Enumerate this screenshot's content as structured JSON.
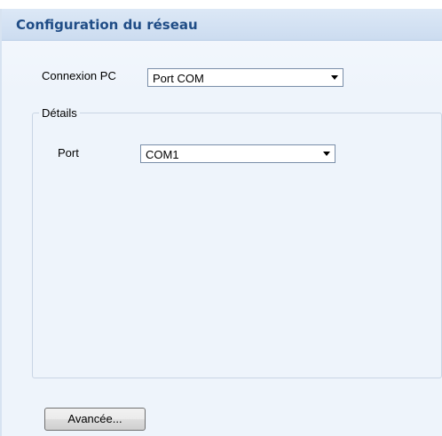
{
  "panel": {
    "title": "Configuration du réseau"
  },
  "connection": {
    "label": "Connexion PC",
    "selected": "Port COM"
  },
  "details": {
    "legend": "Détails",
    "port_label": "Port",
    "port_selected": "COM1"
  },
  "buttons": {
    "advanced_label": "Avancée..."
  },
  "icons": {
    "dropdown": "chevron-down-icon"
  },
  "colors": {
    "title_text": "#1f4c86",
    "header_bg": "#d4e2f4",
    "panel_bg": "#eef4fb"
  }
}
